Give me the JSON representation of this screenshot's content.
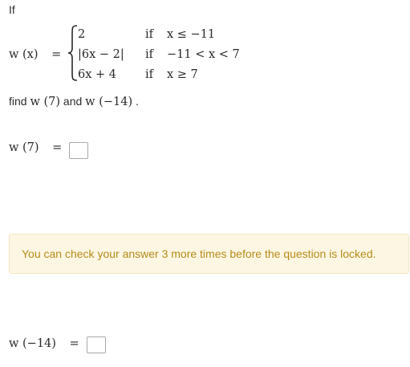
{
  "intro": "If",
  "function": {
    "lhs": "w (x)",
    "equals": "=",
    "cases": [
      {
        "value": "2",
        "if": "if",
        "condition": "x ≤ −11"
      },
      {
        "value": "|6x − 2|",
        "if": "if",
        "condition": "−11 < x < 7"
      },
      {
        "value": "6x + 4",
        "if": "if",
        "condition": "x ≥ 7"
      }
    ]
  },
  "prompt": {
    "find": "find",
    "expr1": "w (7)",
    "and": "and",
    "expr2": "w (−14)",
    "period": "."
  },
  "q1": {
    "label": "w (7)",
    "equals": "="
  },
  "notice": "You can check your answer 3 more times before the question is locked.",
  "q2": {
    "label": "w (−14)",
    "equals": "="
  }
}
